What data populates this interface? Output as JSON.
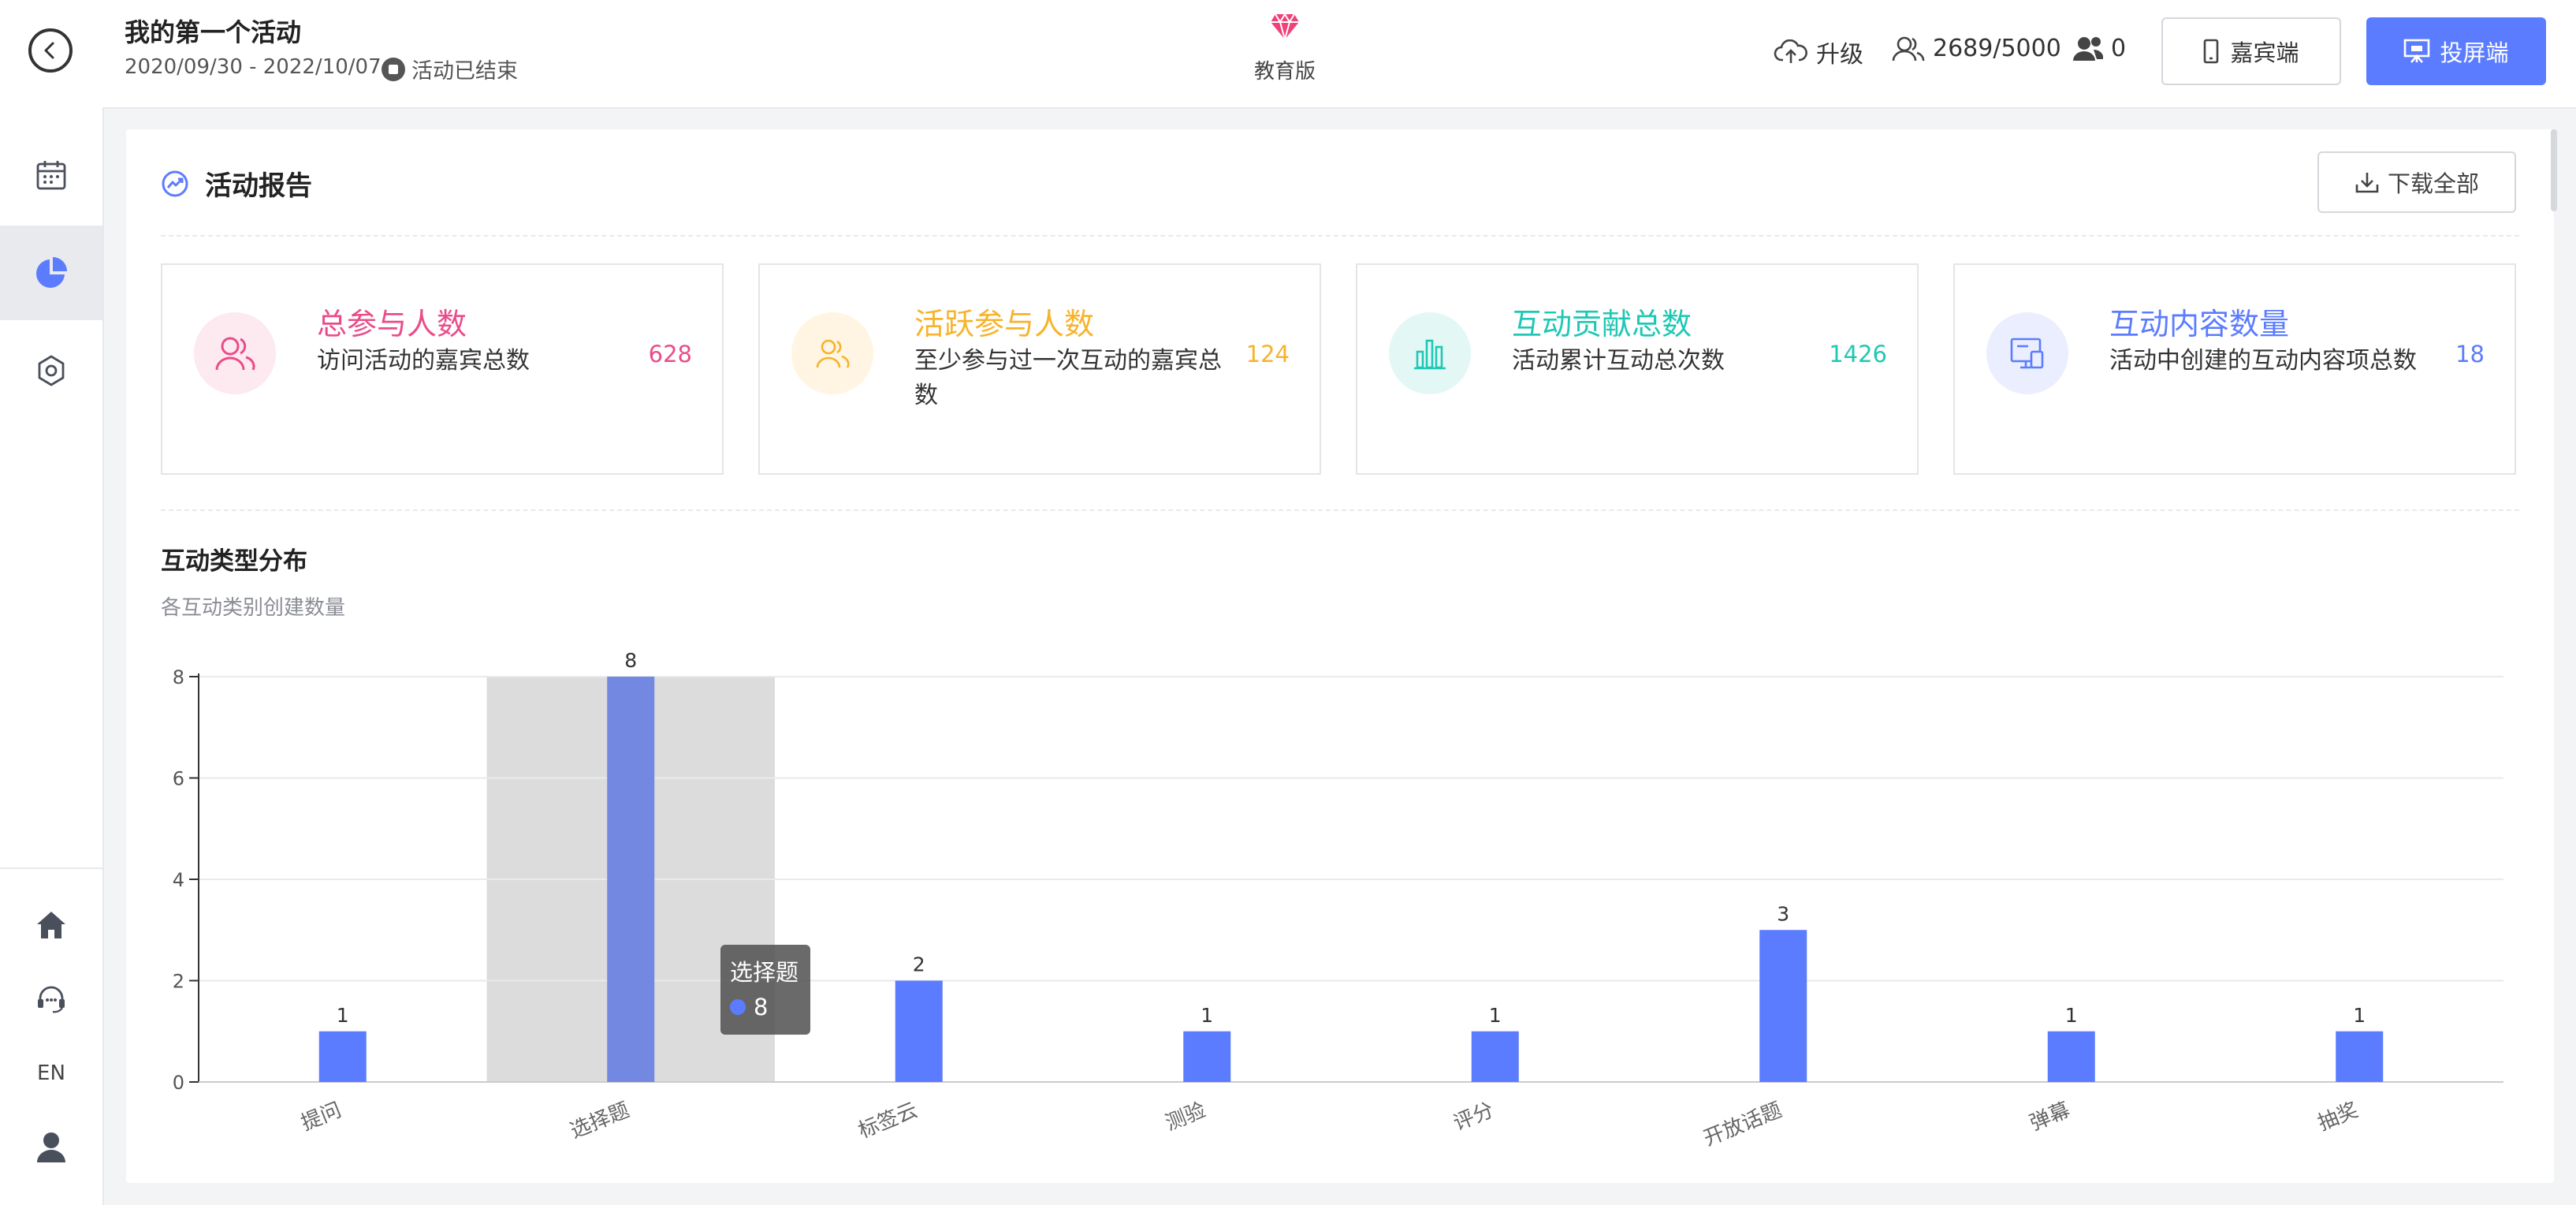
{
  "header": {
    "title": "我的第一个活动",
    "date_range": "2020/09/30 - 2022/10/07",
    "status": "活动已结束",
    "edition": "教育版",
    "upgrade": "升级",
    "users": "2689/5000",
    "online": "0",
    "guest_button": "嘉宾端",
    "screen_button": "投屏端"
  },
  "sidebar": {
    "top_items": [
      "calendar-icon",
      "pie-chart-icon",
      "settings-icon"
    ],
    "active_item": "pie-chart-icon",
    "bottom_items": [
      "home-icon",
      "support-icon",
      "language",
      "user-icon"
    ],
    "language": "EN"
  },
  "report": {
    "title": "活动报告",
    "download_button": "下载全部"
  },
  "stats": [
    {
      "name": "总参与人数",
      "desc": "访问活动的嘉宾总数",
      "value": "628",
      "color": "#ea4c89",
      "bg": "#fde9f0",
      "icon": "users-icon"
    },
    {
      "name": "活跃参与人数",
      "desc": "至少参与过一次互动的嘉宾总数",
      "value": "124",
      "color": "#f7b32b",
      "bg": "#fff5e2",
      "icon": "active-users-icon"
    },
    {
      "name": "互动贡献总数",
      "desc": "活动累计互动总次数",
      "value": "1426",
      "color": "#1fc8b4",
      "bg": "#e3f8f5",
      "icon": "bar-chart-icon"
    },
    {
      "name": "互动内容数量",
      "desc": "活动中创建的互动内容项总数",
      "value": "18",
      "color": "#5b7cff",
      "bg": "#eaeefe",
      "icon": "screen-icon"
    }
  ],
  "chart_section": {
    "title": "互动类型分布",
    "subtitle": "各互动类别创建数量"
  },
  "tooltip": {
    "label": "选择题",
    "value": "8"
  },
  "chart_data": {
    "type": "bar",
    "categories": [
      "提问",
      "选择题",
      "标签云",
      "测验",
      "评分",
      "开放话题",
      "弹幕",
      "抽奖"
    ],
    "values": [
      1,
      8,
      2,
      1,
      1,
      3,
      1,
      1
    ],
    "ylim": [
      0,
      8
    ],
    "yticks": [
      0,
      2,
      4,
      6,
      8
    ],
    "highlighted_category": "选择题",
    "bar_color": "#5b7cff",
    "highlight_bar_color": "#7388e0",
    "grid": true
  }
}
